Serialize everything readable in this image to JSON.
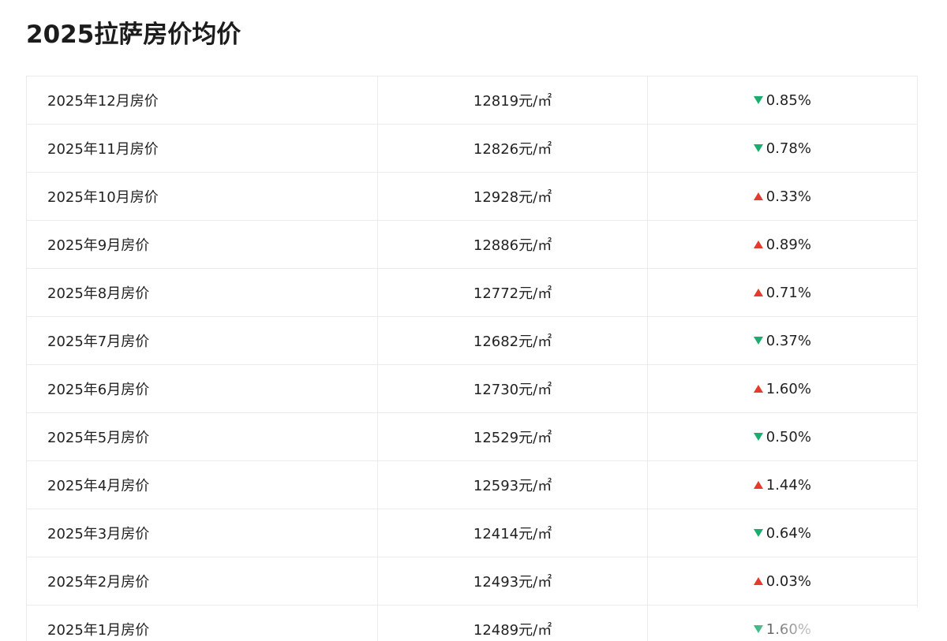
{
  "title": "2025拉萨房价均价",
  "colors": {
    "up": "#e23c2e",
    "down": "#1aad6f"
  },
  "rows": [
    {
      "month": "2025年12月房价",
      "price": "12819元/㎡",
      "direction": "down",
      "change": "0.85%"
    },
    {
      "month": "2025年11月房价",
      "price": "12826元/㎡",
      "direction": "down",
      "change": "0.78%"
    },
    {
      "month": "2025年10月房价",
      "price": "12928元/㎡",
      "direction": "up",
      "change": "0.33%"
    },
    {
      "month": "2025年9月房价",
      "price": "12886元/㎡",
      "direction": "up",
      "change": "0.89%"
    },
    {
      "month": "2025年8月房价",
      "price": "12772元/㎡",
      "direction": "up",
      "change": "0.71%"
    },
    {
      "month": "2025年7月房价",
      "price": "12682元/㎡",
      "direction": "down",
      "change": "0.37%"
    },
    {
      "month": "2025年6月房价",
      "price": "12730元/㎡",
      "direction": "up",
      "change": "1.60%"
    },
    {
      "month": "2025年5月房价",
      "price": "12529元/㎡",
      "direction": "down",
      "change": "0.50%"
    },
    {
      "month": "2025年4月房价",
      "price": "12593元/㎡",
      "direction": "up",
      "change": "1.44%"
    },
    {
      "month": "2025年3月房价",
      "price": "12414元/㎡",
      "direction": "down",
      "change": "0.64%"
    },
    {
      "month": "2025年2月房价",
      "price": "12493元/㎡",
      "direction": "up",
      "change": "0.03%"
    },
    {
      "month": "2025年1月房价",
      "price": "12489元/㎡",
      "direction": "down",
      "change": "1.60%"
    }
  ]
}
